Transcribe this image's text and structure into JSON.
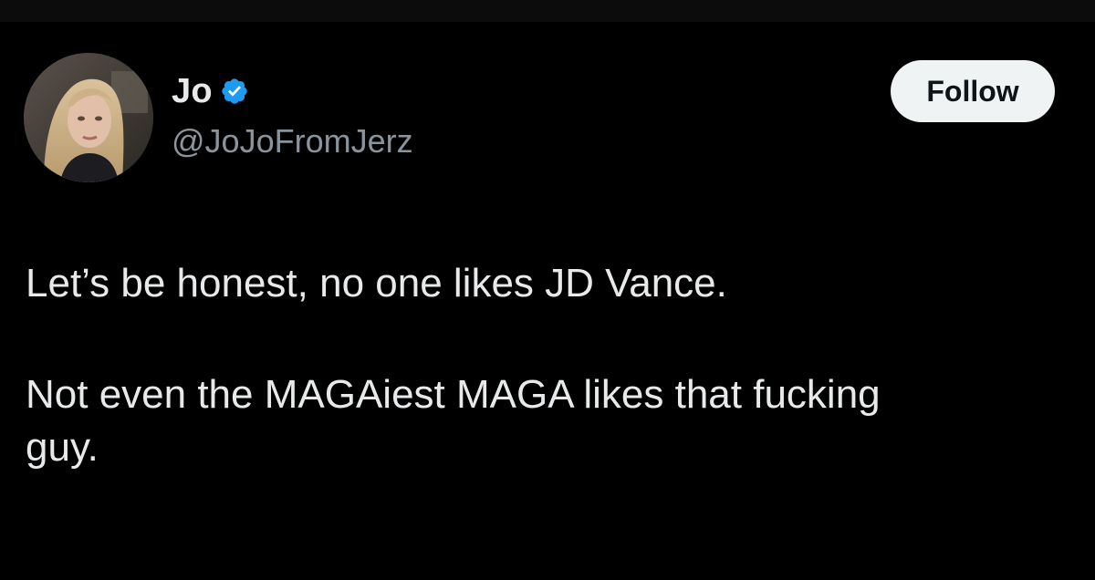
{
  "tweet": {
    "author": {
      "display_name": "Jo",
      "handle": "@JoJoFromJerz",
      "verified": true,
      "verified_color": "#1d9bf0"
    },
    "follow_button_label": "Follow",
    "text": {
      "paragraph_1": "Let’s be honest, no one likes JD Vance.",
      "paragraph_2_line_1": "Not even the MAGAiest MAGA likes that fucking",
      "paragraph_2_line_2": "guy."
    }
  },
  "theme": {
    "background": "#000000",
    "text_primary": "#e7e9ea",
    "text_secondary": "#8b949c",
    "button_bg": "#eff3f4",
    "button_text": "#0f1419"
  },
  "icons": {
    "verified": "verified-badge-icon",
    "avatar": "profile-photo"
  }
}
